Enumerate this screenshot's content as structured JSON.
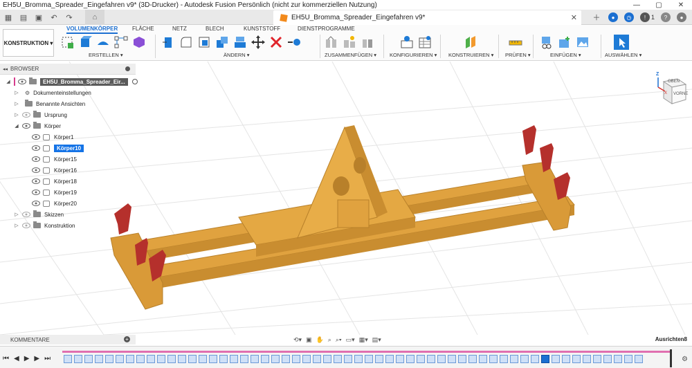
{
  "app": {
    "window_title": "EH5U_Bromma_Spreader_Eingefahren v9* (3D-Drucker) - Autodesk Fusion Persönlich (nicht zur kommerziellen Nutzung)",
    "document_tab": "EH5U_Bromma_Spreader_Eingefahren v9*",
    "notification_count": "1"
  },
  "ribbon": {
    "workspace": "KONSTRUKTION ▾",
    "tabs": [
      "VOLUMENKÖRPER",
      "FLÄCHE",
      "NETZ",
      "BLECH",
      "KUNSTSTOFF",
      "DIENSTPROGRAMME"
    ],
    "groups": [
      "ERSTELLEN ▾",
      "ÄNDERN ▾",
      "ZUSAMMENFÜGEN ▾",
      "KONFIGURIEREN ▾",
      "KONSTRUIEREN ▾",
      "PRÜFEN ▾",
      "EINFÜGEN ▾",
      "AUSWÄHLEN ▾"
    ]
  },
  "browser": {
    "header": "BROWSER",
    "root": "EH5U_Bromma_Spreader_Eir...",
    "items": [
      {
        "label": "Dokumenteinstellungen"
      },
      {
        "label": "Benannte Ansichten"
      },
      {
        "label": "Ursprung"
      },
      {
        "label": "Körper"
      },
      {
        "label": "Körper1"
      },
      {
        "label": "Körper10"
      },
      {
        "label": "Körper15"
      },
      {
        "label": "Körper16"
      },
      {
        "label": "Körper18"
      },
      {
        "label": "Körper19"
      },
      {
        "label": "Körper20"
      },
      {
        "label": "Skizzen"
      },
      {
        "label": "Konstruktion"
      }
    ]
  },
  "viewcube": {
    "top": "OBEN",
    "front": "VORNE",
    "axis_z": "Z",
    "axis_x": "X"
  },
  "bottom": {
    "comments": "KOMMENTARE",
    "status": "Ausrichten8"
  },
  "colors": {
    "model": "#e0a23f",
    "model_dark": "#b8802a",
    "twistlock": "#b5302c",
    "accent": "#1b6fd1"
  }
}
